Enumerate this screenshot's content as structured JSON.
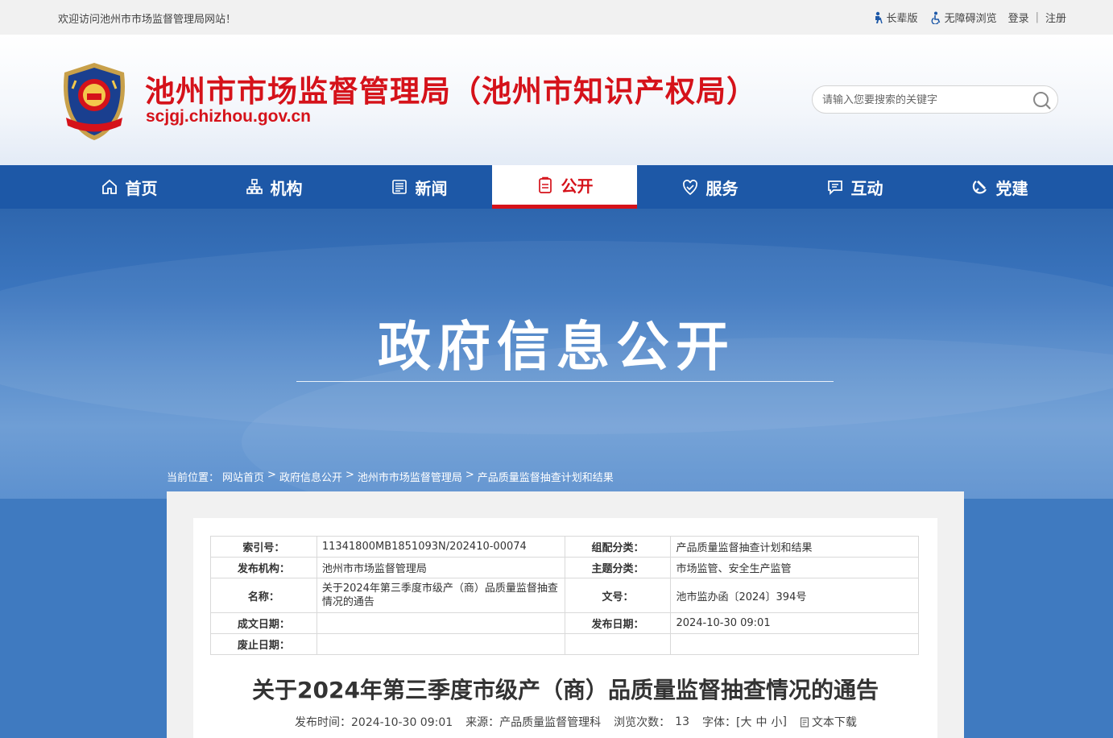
{
  "topbar": {
    "welcome": "欢迎访问池州市市场监督管理局网站！",
    "elder": "长辈版",
    "accessible": "无障碍浏览",
    "login": "登录",
    "separator": "|",
    "register": "注册"
  },
  "header": {
    "title": "池州市市场监督管理局（池州市知识产权局）",
    "domain": "scjgj.chizhou.gov.cn",
    "search_placeholder": "请输入您要搜索的关键字"
  },
  "nav": {
    "items": [
      {
        "label": "首页",
        "icon": "home-icon"
      },
      {
        "label": "机构",
        "icon": "org-icon"
      },
      {
        "label": "新闻",
        "icon": "news-icon"
      },
      {
        "label": "公开",
        "icon": "open-icon",
        "active": true
      },
      {
        "label": "服务",
        "icon": "service-icon"
      },
      {
        "label": "互动",
        "icon": "chat-icon"
      },
      {
        "label": "党建",
        "icon": "party-icon"
      }
    ]
  },
  "banner": {
    "title": "政府信息公开"
  },
  "breadcrumb": {
    "prefix": "当前位置：",
    "items": [
      "网站首页",
      "政府信息公开",
      "池州市市场监督管理局",
      "产品质量监督抽查计划和结果"
    ],
    "separator": ">"
  },
  "meta": {
    "index_label": "索引号：",
    "index_value": "11341800MB1851093N/202410-00074",
    "category_label": "组配分类：",
    "category_value": "产品质量监督抽查计划和结果",
    "publisher_label": "发布机构：",
    "publisher_value": "池州市市场监督管理局",
    "topic_label": "主题分类：",
    "topic_value": "市场监管、安全生产监管",
    "name_label": "名称：",
    "name_value": "关于2024年第三季度市级产（商）品质量监督抽查情况的通告",
    "docno_label": "文号：",
    "docno_value": "池市监办函〔2024〕394号",
    "created_label": "成文日期：",
    "created_value": "",
    "pubdate_label": "发布日期：",
    "pubdate_value": "2024-10-30 09:01",
    "expire_label": "废止日期：",
    "expire_value": ""
  },
  "article": {
    "title": "关于2024年第三季度市级产（商）品质量监督抽查情况的通告",
    "pubtime": "发布时间：2024-10-30 09:01",
    "source": "来源：产品质量监督管理科",
    "views_label": "浏览次数：",
    "views": "13",
    "font_label": "字体：[",
    "font_large": "大",
    "font_medium": "中",
    "font_small": "小",
    "font_end": "]",
    "download": "文本下载"
  },
  "colors": {
    "brand_red": "#d5121a",
    "nav_blue": "#1d58a7"
  }
}
